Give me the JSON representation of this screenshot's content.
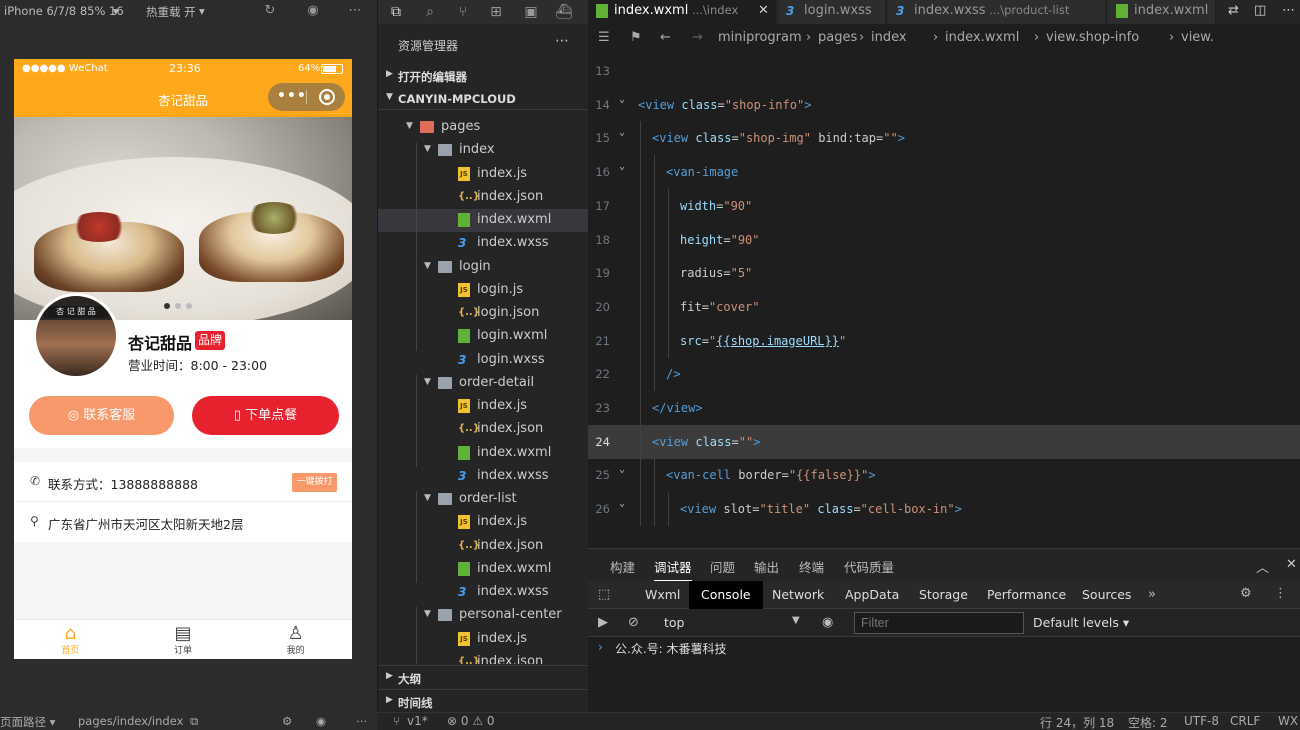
{
  "simulator": {
    "device": "iPhone 6/7/8 85% 16",
    "hot_reload": "热重载 开",
    "status": {
      "carrier": "●●●●● WeChat",
      "time": "23:36",
      "battery": "64%"
    },
    "nav_title": "杏记甜品",
    "shop": {
      "name": "杏记甜品",
      "badge": "品牌",
      "hours": "营业时间：8:00 - 23:00",
      "avatar_sign": "杏 记 甜 品",
      "btn_service": "联系客服",
      "btn_order": "下单点餐",
      "phone": "联系方式：13888888888",
      "dial": "一键拨打",
      "address": "广东省广州市天河区太阳新天地2层"
    },
    "tabbar": [
      {
        "label": "首页",
        "icon": "home-icon"
      },
      {
        "label": "订单",
        "icon": "order-icon"
      },
      {
        "label": "我的",
        "icon": "user-icon"
      }
    ],
    "footer": {
      "path_label": "页面路径 ▾",
      "path": "pages/index/index"
    }
  },
  "explorer": {
    "title": "资源管理器",
    "open_editors": "打开的编辑器",
    "project": "CANYIN-MPCLOUD",
    "tree": [
      {
        "name": "pages",
        "type": "folder-red",
        "depth": 0
      },
      {
        "name": "index",
        "type": "folder",
        "depth": 1
      },
      {
        "name": "index.js",
        "type": "js",
        "depth": 2
      },
      {
        "name": "index.json",
        "type": "json",
        "depth": 2
      },
      {
        "name": "index.wxml",
        "type": "wxml",
        "depth": 2,
        "selected": true
      },
      {
        "name": "index.wxss",
        "type": "wxss",
        "depth": 2
      },
      {
        "name": "login",
        "type": "folder",
        "depth": 1
      },
      {
        "name": "login.js",
        "type": "js",
        "depth": 2
      },
      {
        "name": "login.json",
        "type": "json",
        "depth": 2
      },
      {
        "name": "login.wxml",
        "type": "wxml",
        "depth": 2
      },
      {
        "name": "login.wxss",
        "type": "wxss",
        "depth": 2
      },
      {
        "name": "order-detail",
        "type": "folder",
        "depth": 1
      },
      {
        "name": "index.js",
        "type": "js",
        "depth": 2
      },
      {
        "name": "index.json",
        "type": "json",
        "depth": 2
      },
      {
        "name": "index.wxml",
        "type": "wxml",
        "depth": 2
      },
      {
        "name": "index.wxss",
        "type": "wxss",
        "depth": 2
      },
      {
        "name": "order-list",
        "type": "folder",
        "depth": 1
      },
      {
        "name": "index.js",
        "type": "js",
        "depth": 2
      },
      {
        "name": "index.json",
        "type": "json",
        "depth": 2
      },
      {
        "name": "index.wxml",
        "type": "wxml",
        "depth": 2
      },
      {
        "name": "index.wxss",
        "type": "wxss",
        "depth": 2
      },
      {
        "name": "personal-center",
        "type": "folder",
        "depth": 1
      },
      {
        "name": "index.js",
        "type": "js",
        "depth": 2
      },
      {
        "name": "index.json",
        "type": "json",
        "depth": 2
      }
    ],
    "outline": "大纲",
    "timeline": "时间线"
  },
  "editor": {
    "tabs": [
      {
        "name": "index.wxml",
        "sub": "...\\index",
        "type": "wxml",
        "active": true
      },
      {
        "name": "login.wxss",
        "sub": "",
        "type": "wxss"
      },
      {
        "name": "index.wxss",
        "sub": "...\\product-list",
        "type": "wxss"
      },
      {
        "name": "index.wxml",
        "sub": "",
        "type": "wxml"
      }
    ],
    "breadcrumb": [
      "miniprogram",
      "pages",
      "index",
      "index.wxml",
      "view.shop-info",
      "view."
    ],
    "lines": [
      {
        "n": "13",
        "indent": 0,
        "html": ""
      },
      {
        "n": "14",
        "indent": 0,
        "fold": true,
        "html": "<span class=\"tg\">&lt;view</span> <span class=\"at\">class</span>=<span class=\"st\">\"shop-info\"</span><span class=\"tg\">&gt;</span>"
      },
      {
        "n": "15",
        "indent": 1,
        "fold": true,
        "html": "<span class=\"tg\">&lt;view</span> <span class=\"at\">class</span>=<span class=\"st\">\"shop-img\"</span> <span class=\"attr2\">bind:tap</span>=<span class=\"st\">\"\"</span><span class=\"tg\">&gt;</span>"
      },
      {
        "n": "16",
        "indent": 2,
        "fold": true,
        "html": "<span class=\"tg\">&lt;van-image</span>"
      },
      {
        "n": "17",
        "indent": 3,
        "html": "<span class=\"at\">width</span>=<span class=\"st\">\"90\"</span>"
      },
      {
        "n": "18",
        "indent": 3,
        "html": "<span class=\"at\">height</span>=<span class=\"st\">\"90\"</span>"
      },
      {
        "n": "19",
        "indent": 3,
        "html": "<span class=\"attr2\">radius</span>=<span class=\"st\">\"5\"</span>"
      },
      {
        "n": "20",
        "indent": 3,
        "html": "<span class=\"attr2\">fit</span>=<span class=\"st\">\"cover\"</span>"
      },
      {
        "n": "21",
        "indent": 3,
        "html": "<span class=\"at\">src</span>=<span class=\"st\">\"</span><span class=\"at\" style=\"text-decoration:underline\">{{shop.imageURL}}</span><span class=\"st\">\"</span>"
      },
      {
        "n": "22",
        "indent": 2,
        "html": "<span class=\"tg\">/&gt;</span>"
      },
      {
        "n": "23",
        "indent": 1,
        "html": "<span class=\"tg\">&lt;/view&gt;</span>"
      },
      {
        "n": "24",
        "indent": 1,
        "current": true,
        "html": "<span class=\"tg\">&lt;view</span> <span class=\"at\">class</span>=<span class=\"st\">\"\"</span><span class=\"tg\">&gt;</span>"
      },
      {
        "n": "25",
        "indent": 2,
        "fold": true,
        "html": "<span class=\"tg\">&lt;van-cell</span> <span class=\"attr2\">border</span>=<span class=\"st\">\"{{false}}\"</span><span class=\"tg\">&gt;</span>"
      },
      {
        "n": "26",
        "indent": 3,
        "fold": true,
        "html": "<span class=\"tg\">&lt;view</span> <span class=\"attr2\">slot</span>=<span class=\"st\">\"title\"</span> <span class=\"at\">class</span>=<span class=\"st\">\"cell-box-in\"</span><span class=\"tg\">&gt;</span>"
      }
    ]
  },
  "panel": {
    "tabs": [
      "构建",
      "调试器",
      "问题",
      "输出",
      "终端",
      "代码质量"
    ],
    "active_tab": "调试器",
    "devtools_tabs": [
      "Wxml",
      "Console",
      "Network",
      "AppData",
      "Storage",
      "Performance",
      "Sources"
    ],
    "active_devtool": "Console",
    "context": "top",
    "filter_placeholder": "Filter",
    "levels": "Default levels ▾",
    "log": "公.众.号: 木番薯科技"
  },
  "statusbar": {
    "branch": "v1*",
    "problems": "⊗ 0 ⚠ 0",
    "position": "行 24，列 18",
    "spaces": "空格: 2",
    "encoding": "UTF-8",
    "eol": "CRLF",
    "lang": "WX"
  }
}
